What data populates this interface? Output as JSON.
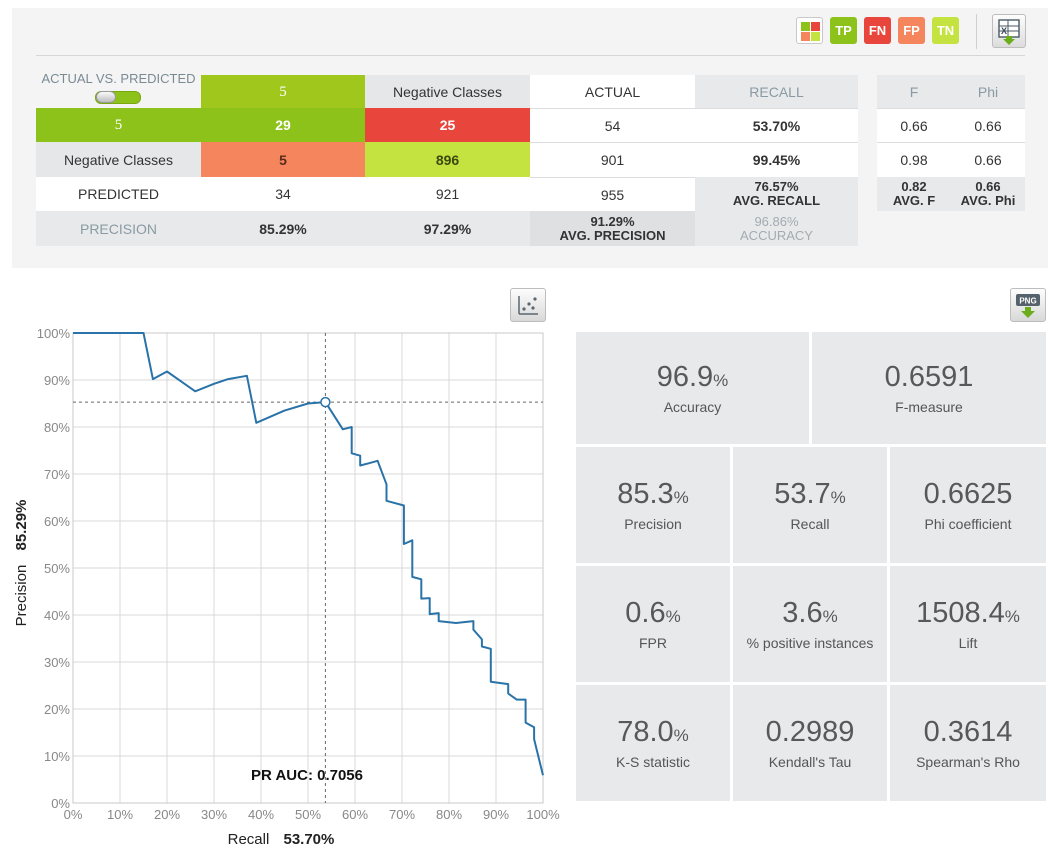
{
  "toolbar": {
    "legend": [
      {
        "label": "TP",
        "color": "#8dc21a"
      },
      {
        "label": "FN",
        "color": "#e8453c"
      },
      {
        "label": "FP",
        "color": "#f4855d"
      },
      {
        "label": "TN",
        "color": "#c4e240"
      }
    ],
    "grid_colors": [
      "#8dc21a",
      "#e8453c",
      "#f4855d",
      "#c4e240"
    ]
  },
  "matrix": {
    "corner_title": "ACTUAL VS. PREDICTED",
    "col_headers": [
      "5",
      "Negative Classes",
      "ACTUAL",
      "RECALL",
      "F",
      "Phi"
    ],
    "rows": [
      {
        "label": "5",
        "tp": "29",
        "fn": "25",
        "actual": "54",
        "recall": "53.70%",
        "f": "0.66",
        "phi": "0.66"
      },
      {
        "label": "Negative Classes",
        "fp": "5",
        "tn": "896",
        "actual": "901",
        "recall": "99.45%",
        "f": "0.98",
        "phi": "0.66"
      }
    ],
    "predicted_row": {
      "label": "PREDICTED",
      "c1": "34",
      "c2": "921",
      "total": "955",
      "avg_recall": "76.57%",
      "avg_recall_label": "AVG. RECALL",
      "avg_f": "0.82",
      "avg_f_label": "AVG. F",
      "avg_phi": "0.66",
      "avg_phi_label": "AVG. Phi"
    },
    "precision_row": {
      "label": "PRECISION",
      "c1": "85.29%",
      "c2": "97.29%",
      "avg_precision": "91.29%",
      "avg_precision_label": "AVG. PRECISION",
      "accuracy": "96.86%",
      "accuracy_label": "ACCURACY"
    }
  },
  "metrics": [
    {
      "value": "96.9",
      "unit": "%",
      "label": "Accuracy"
    },
    {
      "value": "0.6591",
      "unit": "",
      "label": "F-measure"
    },
    {
      "value": "85.3",
      "unit": "%",
      "label": "Precision"
    },
    {
      "value": "53.7",
      "unit": "%",
      "label": "Recall"
    },
    {
      "value": "0.6625",
      "unit": "",
      "label": "Phi coefficient"
    },
    {
      "value": "0.6",
      "unit": "%",
      "label": "FPR"
    },
    {
      "value": "3.6",
      "unit": "%",
      "label": "% positive instances"
    },
    {
      "value": "1508.4",
      "unit": "%",
      "label": "Lift"
    },
    {
      "value": "78.0",
      "unit": "%",
      "label": "K-S statistic"
    },
    {
      "value": "0.2989",
      "unit": "",
      "label": "Kendall's Tau"
    },
    {
      "value": "0.3614",
      "unit": "",
      "label": "Spearman's Rho"
    }
  ],
  "chart_data": {
    "type": "line",
    "xlabel": "Recall",
    "ylabel": "Precision",
    "x_marker_value": "53.70%",
    "y_marker_value": "85.29%",
    "annotation": "PR AUC: 0.7056",
    "xlim": [
      0,
      100
    ],
    "ylim": [
      0,
      100
    ],
    "x_ticks": [
      "0%",
      "10%",
      "20%",
      "30%",
      "40%",
      "50%",
      "60%",
      "70%",
      "80%",
      "90%",
      "100%"
    ],
    "y_ticks": [
      "0%",
      "10%",
      "20%",
      "30%",
      "40%",
      "50%",
      "60%",
      "70%",
      "80%",
      "90%",
      "100%"
    ],
    "grid": true,
    "marker": {
      "x": 53.7,
      "y": 85.29
    },
    "series": [
      {
        "color": "#2a73a8",
        "points": [
          [
            0,
            100
          ],
          [
            15,
            100
          ],
          [
            17,
            90.2
          ],
          [
            20,
            91.8
          ],
          [
            26,
            87.6
          ],
          [
            30,
            89.2
          ],
          [
            33,
            90.2
          ],
          [
            37,
            90.9
          ],
          [
            39,
            80.9
          ],
          [
            45,
            83.5
          ],
          [
            50,
            85
          ],
          [
            53.7,
            85.29
          ],
          [
            57.4,
            79.5
          ],
          [
            59.3,
            80
          ],
          [
            59.3,
            74.4
          ],
          [
            61.1,
            73.9
          ],
          [
            61.1,
            71.8
          ],
          [
            63,
            72.3
          ],
          [
            64.8,
            72.8
          ],
          [
            66.7,
            67.8
          ],
          [
            66.7,
            64.3
          ],
          [
            70.4,
            63.3
          ],
          [
            70.4,
            55.1
          ],
          [
            72.2,
            55.9
          ],
          [
            72.2,
            48.1
          ],
          [
            74.1,
            47.6
          ],
          [
            74.1,
            43.5
          ],
          [
            75.9,
            43.6
          ],
          [
            75.9,
            40.2
          ],
          [
            77.8,
            40.4
          ],
          [
            77.8,
            38.7
          ],
          [
            81.5,
            38.3
          ],
          [
            85.2,
            38.7
          ],
          [
            85.2,
            36.9
          ],
          [
            87,
            34.8
          ],
          [
            87,
            33.3
          ],
          [
            88.9,
            32.8
          ],
          [
            88.9,
            25.8
          ],
          [
            92.6,
            25.3
          ],
          [
            92.6,
            23.3
          ],
          [
            94.4,
            22
          ],
          [
            96.3,
            22
          ],
          [
            96.3,
            17.1
          ],
          [
            98.1,
            16.1
          ],
          [
            98.1,
            13.6
          ],
          [
            100,
            5.9
          ]
        ]
      }
    ]
  }
}
